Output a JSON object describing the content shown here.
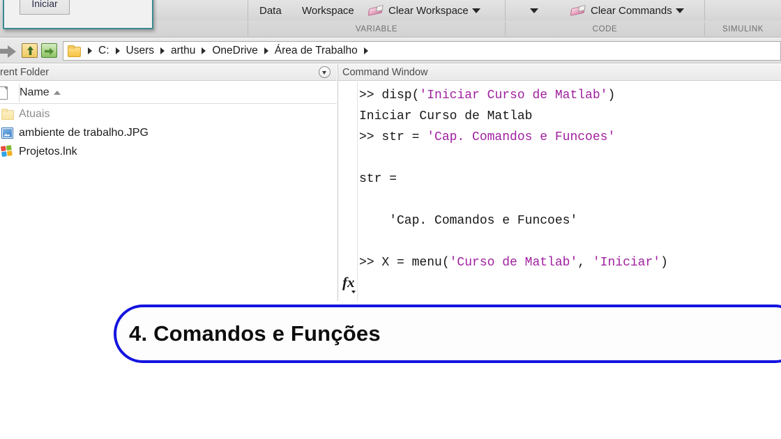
{
  "ribbon": {
    "items": [
      {
        "label": "Data",
        "icon": null,
        "caret": false
      },
      {
        "label": "Workspace",
        "icon": null,
        "caret": false
      },
      {
        "label": "Clear Workspace",
        "icon": "eraser-icon",
        "caret": true
      },
      {
        "label": "",
        "icon": null,
        "caret": true
      },
      {
        "label": "Clear Commands",
        "icon": "eraser-icon",
        "caret": true
      }
    ],
    "groups": [
      {
        "label": "VARIABLE"
      },
      {
        "label": "CODE"
      },
      {
        "label": "SIMULINK"
      }
    ]
  },
  "dialog": {
    "button_label": "Iniciar"
  },
  "pathbar": {
    "forward_icon": "forward-arrow-icon",
    "browse_icon": "browse-folder-icon",
    "up_icon": "go-up-folder-icon",
    "folder_icon": "folder-icon",
    "crumbs": [
      "C:",
      "Users",
      "arthu",
      "OneDrive",
      "Área de Trabalho"
    ]
  },
  "current_folder": {
    "title": "rent Folder",
    "collapse_icon": "chevron-down-circle-icon",
    "column_header": "Name",
    "sort_direction": "asc",
    "files": [
      {
        "name": "Atuais",
        "icon": "folder-icon",
        "dim": true
      },
      {
        "name": "ambiente de trabalho.JPG",
        "icon": "image-file-icon",
        "dim": false
      },
      {
        "name": "Projetos.lnk",
        "icon": "windows-shortcut-icon",
        "dim": false
      }
    ]
  },
  "command_window": {
    "title": "Command Window",
    "fx_icon": "fx-function-icon",
    "lines": [
      [
        {
          "t": ">> disp(",
          "c": "code"
        },
        {
          "t": "'Iniciar Curso de Matlab'",
          "c": "str"
        },
        {
          "t": ")",
          "c": "code"
        }
      ],
      [
        {
          "t": "Iniciar Curso de Matlab",
          "c": "code"
        }
      ],
      [
        {
          "t": ">> str = ",
          "c": "code"
        },
        {
          "t": "'Cap. Comandos e Funcoes'",
          "c": "str"
        }
      ],
      [
        {
          "t": "",
          "c": "code"
        }
      ],
      [
        {
          "t": "str =",
          "c": "code"
        }
      ],
      [
        {
          "t": "",
          "c": "code"
        }
      ],
      [
        {
          "t": "    'Cap. Comandos e Funcoes'",
          "c": "code"
        }
      ],
      [
        {
          "t": "",
          "c": "code"
        }
      ],
      [
        {
          "t": ">> X = menu(",
          "c": "code"
        },
        {
          "t": "'Curso de Matlab'",
          "c": "str"
        },
        {
          "t": ", ",
          "c": "code"
        },
        {
          "t": "'Iniciar'",
          "c": "str"
        },
        {
          "t": ")",
          "c": "code"
        }
      ]
    ]
  },
  "banner": {
    "text": "4.  Comandos e Funções",
    "border_color": "#1414e0"
  },
  "colors": {
    "string_purple": "#a020a0",
    "banner_blue": "#1414e0",
    "dialog_border_teal": "#3a8a90"
  }
}
